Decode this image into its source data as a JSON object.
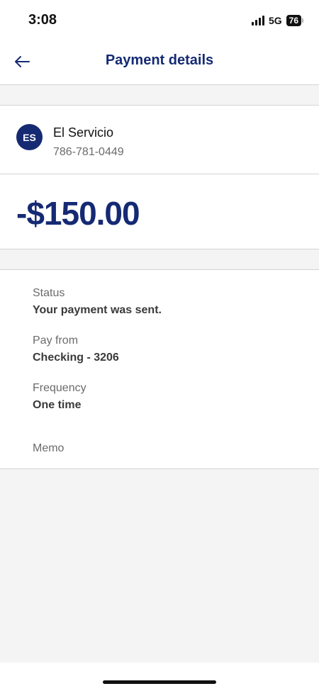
{
  "status_bar": {
    "time": "3:08",
    "network": "5G",
    "battery": "76"
  },
  "header": {
    "title": "Payment details",
    "back_icon": "arrow-left-icon"
  },
  "payee": {
    "initials": "ES",
    "name": "El Servicio",
    "phone": "786-781-0449"
  },
  "payment": {
    "amount": "-$150.00"
  },
  "details": {
    "status_label": "Status",
    "status_value": "Your payment was sent.",
    "pay_from_label": "Pay from",
    "pay_from_value": "Checking - 3206",
    "frequency_label": "Frequency",
    "frequency_value": "One time",
    "memo_label": "Memo"
  },
  "colors": {
    "brand": "#152a73",
    "background": "#f4f4f5",
    "divider": "#d4d4d8"
  }
}
